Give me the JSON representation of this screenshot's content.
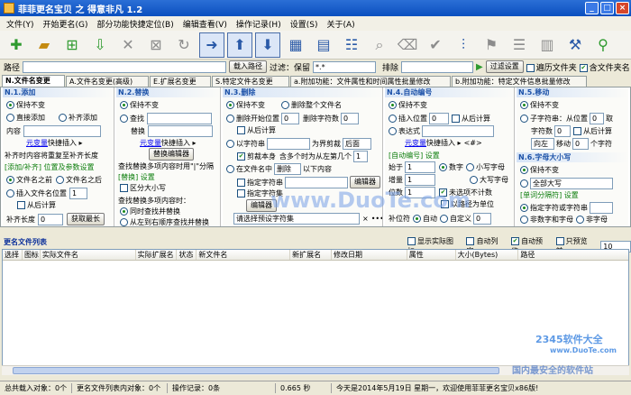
{
  "window": {
    "title": "菲菲更名宝贝 之 得意非凡 1.2",
    "min": "_",
    "max": "□",
    "close": "×"
  },
  "menu": [
    "文件(Y)",
    "开始更名(G)",
    "部分功能快捷定位(B)",
    "编辑查看(V)",
    "操作记录(H)",
    "设置(S)",
    "关于(A)"
  ],
  "pathbar": {
    "path_label": "路径",
    "load_path": "载入路径",
    "filter_label": "过滤：保留",
    "filter_value": "*.*",
    "exclude_label": "排除",
    "filter_settings": "过滤设置",
    "traverse": "遍历文件夹",
    "include_ext": "含文件夹名"
  },
  "tabs": [
    "N.文件名变更",
    "A.文件名变更(高级)",
    "E.扩展名变更",
    "S.特定文件名变更",
    "a.附加功能：文件属性和时间属性批量修改",
    "b.附加功能：特定文件信息批量修改"
  ],
  "p1": {
    "title": "N.1.添加",
    "o1": "保持不变",
    "o2": "直接添加",
    "o3": "补齐添加",
    "content": "内容",
    "var": "元变量",
    "quick": "快捷插入 ▸",
    "n1": "补齐时内容将重复至补齐长度",
    "n2": "[添加/补齐] 位置及参数设置",
    "pos1": "文件名之前",
    "pos2": "文件名之后",
    "pos3": "插入文件名位置",
    "pos3_val": "1",
    "from_right": "从后计算",
    "pad_label": "补齐长度",
    "pad_val": "0",
    "get_len": "获取最长"
  },
  "p2": {
    "title": "N.2.替换",
    "o1": "保持不变",
    "find": "查找",
    "replace": "替换",
    "var": "元变量",
    "quick": "快捷插入 ▸",
    "editor": "替换编辑器",
    "n1": "查找替换多项内容时用\"|\"分隔",
    "n2": "[替换] 设置",
    "case": "区分大小写",
    "n3": "查找替换多项内容时：",
    "m1": "同时查找并替换",
    "m2": "从左到右顺序查找并替换"
  },
  "p3": {
    "title": "N.3.删除",
    "o1": "保持不变",
    "o2": "删除整个文件名",
    "o3": "删除开始位置",
    "v3": "0",
    "o3b": "删除字符数",
    "v3b": "0",
    "from_right": "从后计算",
    "o4": "以字符串",
    "bound": "为界剪裁",
    "after": "后面",
    "cut": "剪裁本身",
    "cut2": "含多个时为从左第几个",
    "cut2_val": "1",
    "o5": "在文件名中",
    "del": "删除",
    "o5b": "以下内容",
    "spec1": "指定字符串",
    "editor1": "编辑器",
    "spec2": "指定字符集",
    "editor2": "编辑器",
    "preset": "请选择预设字符集",
    "x": "×",
    "dots": "•••"
  },
  "p4": {
    "title": "N.4.自动编号",
    "o1": "保持不变",
    "o2": "插入位置",
    "v2": "0",
    "from_right": "从后计算",
    "o3": "表达式",
    "var": "元变量",
    "quick": "快捷插入 ▸",
    "sym": "<#>",
    "n1": "[自动编号] 设置",
    "start": "始于",
    "start_val": "1",
    "num": "数字",
    "lower": "小写字母",
    "step": "增量",
    "step_val": "1",
    "upper": "大写字母",
    "digits": "位数",
    "digits_val": "1",
    "uncount": "未选项不计数",
    "bypath": "以路径为单位",
    "pad": "补位符",
    "auto": "自动",
    "custom": "自定义",
    "custom_val": "0"
  },
  "p5": {
    "title": "N.5.移动",
    "o1": "保持不变",
    "o2": "子字符串：从位置",
    "v2": "0",
    "take": "取",
    "chars": "字符数",
    "chars_val": "0",
    "from_right": "从后计算",
    "dir": "向左",
    "move": "移动",
    "move_val": "0",
    "unit": "个字符",
    "title2": "N.6.字母大小写",
    "o6": "保持不变",
    "o6b": "全部大写",
    "n1": "[单词分隔符] 设置",
    "sep1": "指定字符或字符串",
    "sep2": "非数字和字母",
    "sep3": "非字母"
  },
  "list": {
    "title": "更名文件列表",
    "show_icon": "显示实际图标",
    "auto_width": "自动列宽",
    "auto_preview": "自动预览",
    "preview_only": "只预览前",
    "preview_n": "10",
    "cols": [
      "选择",
      "图标",
      "实际文件名",
      "实际扩展名",
      "状态",
      "新文件名",
      "新扩展名",
      "修改日期",
      "属性",
      "大小(Bytes)",
      "路径"
    ]
  },
  "status": {
    "load": "总共载入对象：0个",
    "list": "更名文件列表内对象：0个",
    "ops": "操作记录：0条",
    "time": "0.665 秒",
    "date": "今天是2014年5月19日 星期一，欢迎使用菲菲更名宝贝x86版!"
  },
  "watermark": {
    "site": "www.DuoTe.com",
    "brand1": "2345软件大全",
    "brand2": "www.DuoTe.com",
    "slogan": "国内最安全的软件站"
  },
  "colors": {
    "title_bar": "#0a4fbf",
    "section_head": "#1d52a8",
    "accent_green": "#0b7d0b"
  }
}
